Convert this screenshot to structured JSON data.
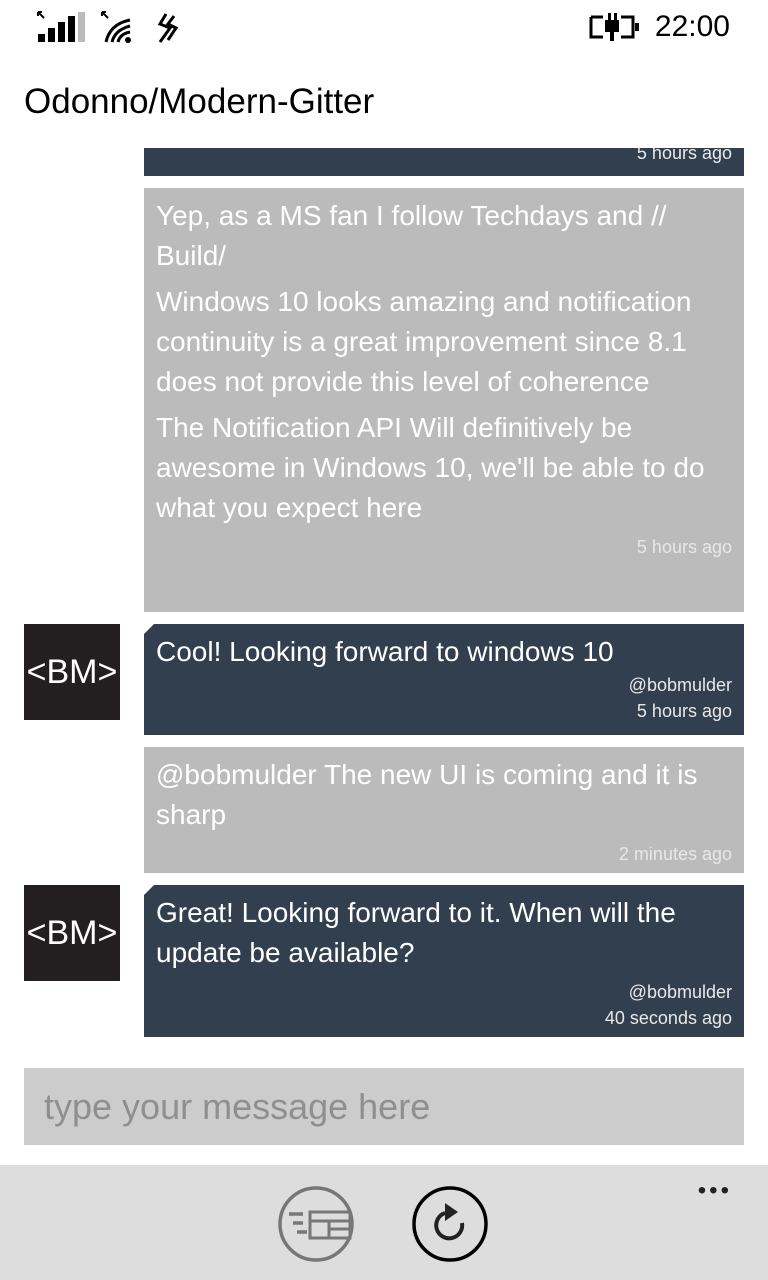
{
  "status_bar": {
    "time": "22:00",
    "icons": [
      "signal-icon",
      "wifi-icon",
      "data-sense-icon",
      "battery-charging-icon"
    ]
  },
  "header": {
    "title": "Odonno/Modern-Gitter"
  },
  "messages": [
    {
      "paragraphs": [],
      "time": "5 hours ago",
      "style": "dark"
    },
    {
      "paragraphs": [
        "Yep, as a MS fan I follow Techdays and // Build/",
        "Windows 10 looks amazing and notification continuity is a great improvement since 8.1 does not provide this level of coherence",
        "The Notification API Will definitively be awesome in Windows 10, we'll be able to do what you expect here"
      ],
      "time": "5 hours ago",
      "style": "gray"
    },
    {
      "avatar": "<BM>",
      "paragraphs": [
        "Cool! Looking forward to windows 10"
      ],
      "user": "@bobmulder",
      "time": "5 hours ago",
      "style": "dark"
    },
    {
      "paragraphs": [
        "@bobmulder The new UI is coming and it is sharp"
      ],
      "time": "2 minutes ago",
      "style": "gray"
    },
    {
      "avatar": "<BM>",
      "paragraphs": [
        "Great! Looking forward to it. When will the update be available?"
      ],
      "user": "@bobmulder",
      "time": "40 seconds ago",
      "style": "dark"
    }
  ],
  "composer": {
    "placeholder": "type your message here"
  },
  "app_bar": {
    "buttons": [
      "rooms-list-icon",
      "refresh-icon"
    ],
    "more": "•••"
  },
  "colors": {
    "dark_bubble": "#323f4e",
    "gray_bubble": "#bbbbbb",
    "avatar_bg": "#231f20",
    "app_bar": "#dddddd",
    "input": "#cccccc"
  }
}
